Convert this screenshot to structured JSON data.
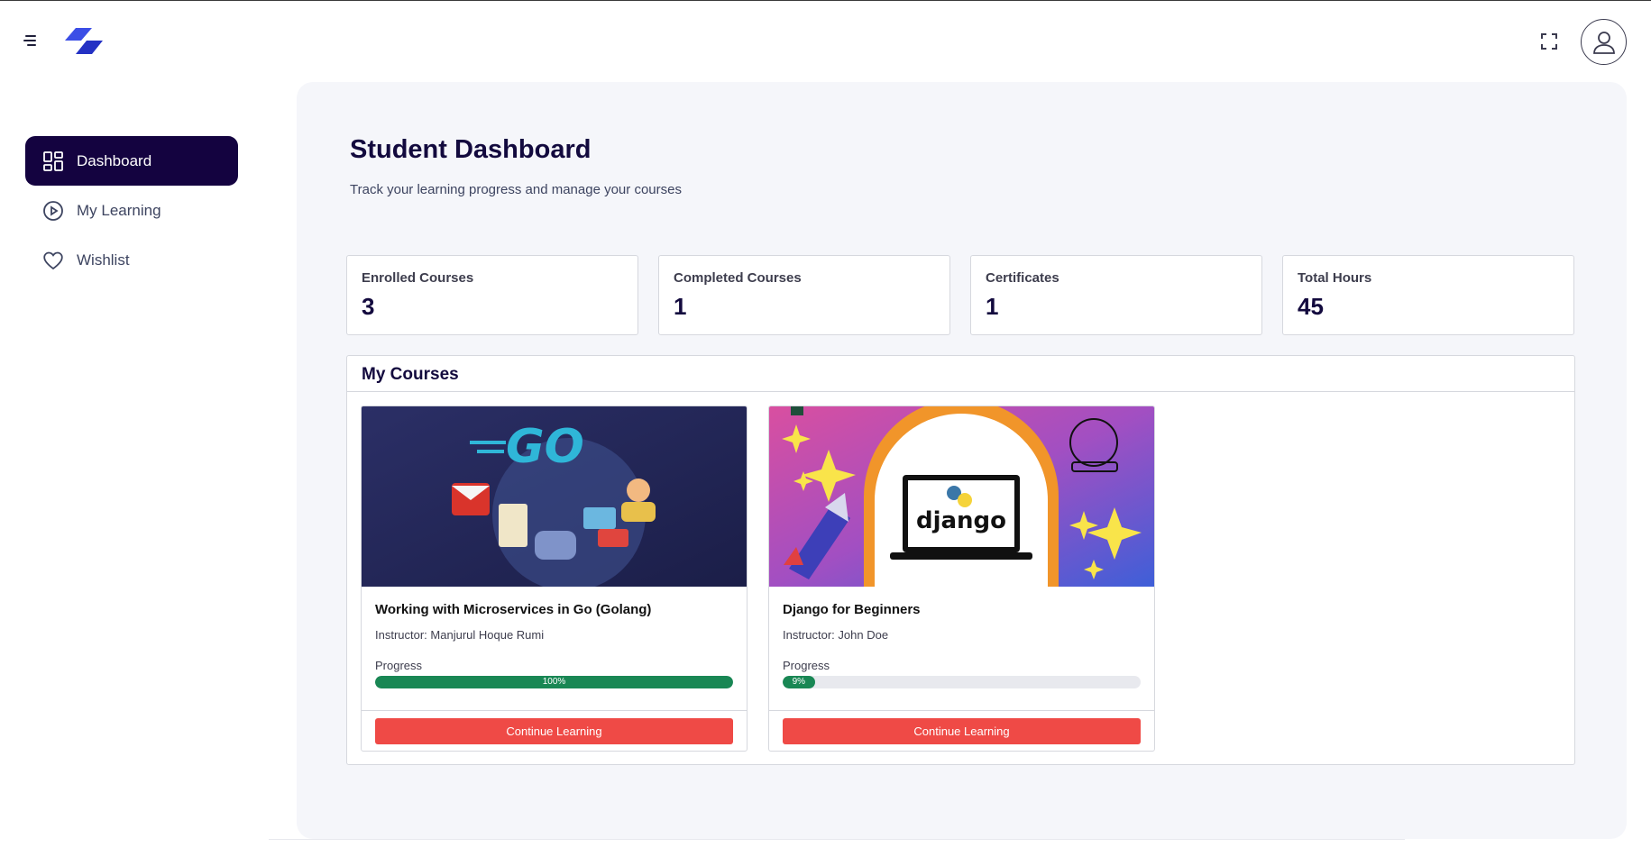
{
  "header": {
    "menu_icon": "hamburger-menu-icon",
    "logo_icon": "brand-logo-icon",
    "fullscreen_icon": "fullscreen-icon",
    "avatar_icon": "user-avatar-icon"
  },
  "sidebar": {
    "items": [
      {
        "label": "Dashboard",
        "icon": "dashboard-grid-icon",
        "active": true
      },
      {
        "label": "My Learning",
        "icon": "play-circle-icon",
        "active": false
      },
      {
        "label": "Wishlist",
        "icon": "heart-icon",
        "active": false
      }
    ]
  },
  "page": {
    "title": "Student Dashboard",
    "subtitle": "Track your learning progress and manage your courses"
  },
  "stats": [
    {
      "label": "Enrolled Courses",
      "value": "3"
    },
    {
      "label": "Completed Courses",
      "value": "1"
    },
    {
      "label": "Certificates",
      "value": "1"
    },
    {
      "label": "Total Hours",
      "value": "45"
    }
  ],
  "courses": {
    "heading": "My Courses",
    "items": [
      {
        "title": "Working with Microservices in Go (Golang)",
        "instructor": "Instructor: Manjurul Hoque Rumi",
        "progress_label": "Progress",
        "progress": 100,
        "progress_text": "100%",
        "button": "Continue Learning",
        "thumb_text": "GO"
      },
      {
        "title": "Django for Beginners",
        "instructor": "Instructor: John Doe",
        "progress_label": "Progress",
        "progress": 9,
        "progress_text": "9%",
        "button": "Continue Learning",
        "thumb_text": "django"
      }
    ]
  },
  "colors": {
    "accent_dark": "#140340",
    "progress_green": "#198754",
    "button_red": "#ef4a46",
    "logo_blue": "#2f3fd6"
  }
}
